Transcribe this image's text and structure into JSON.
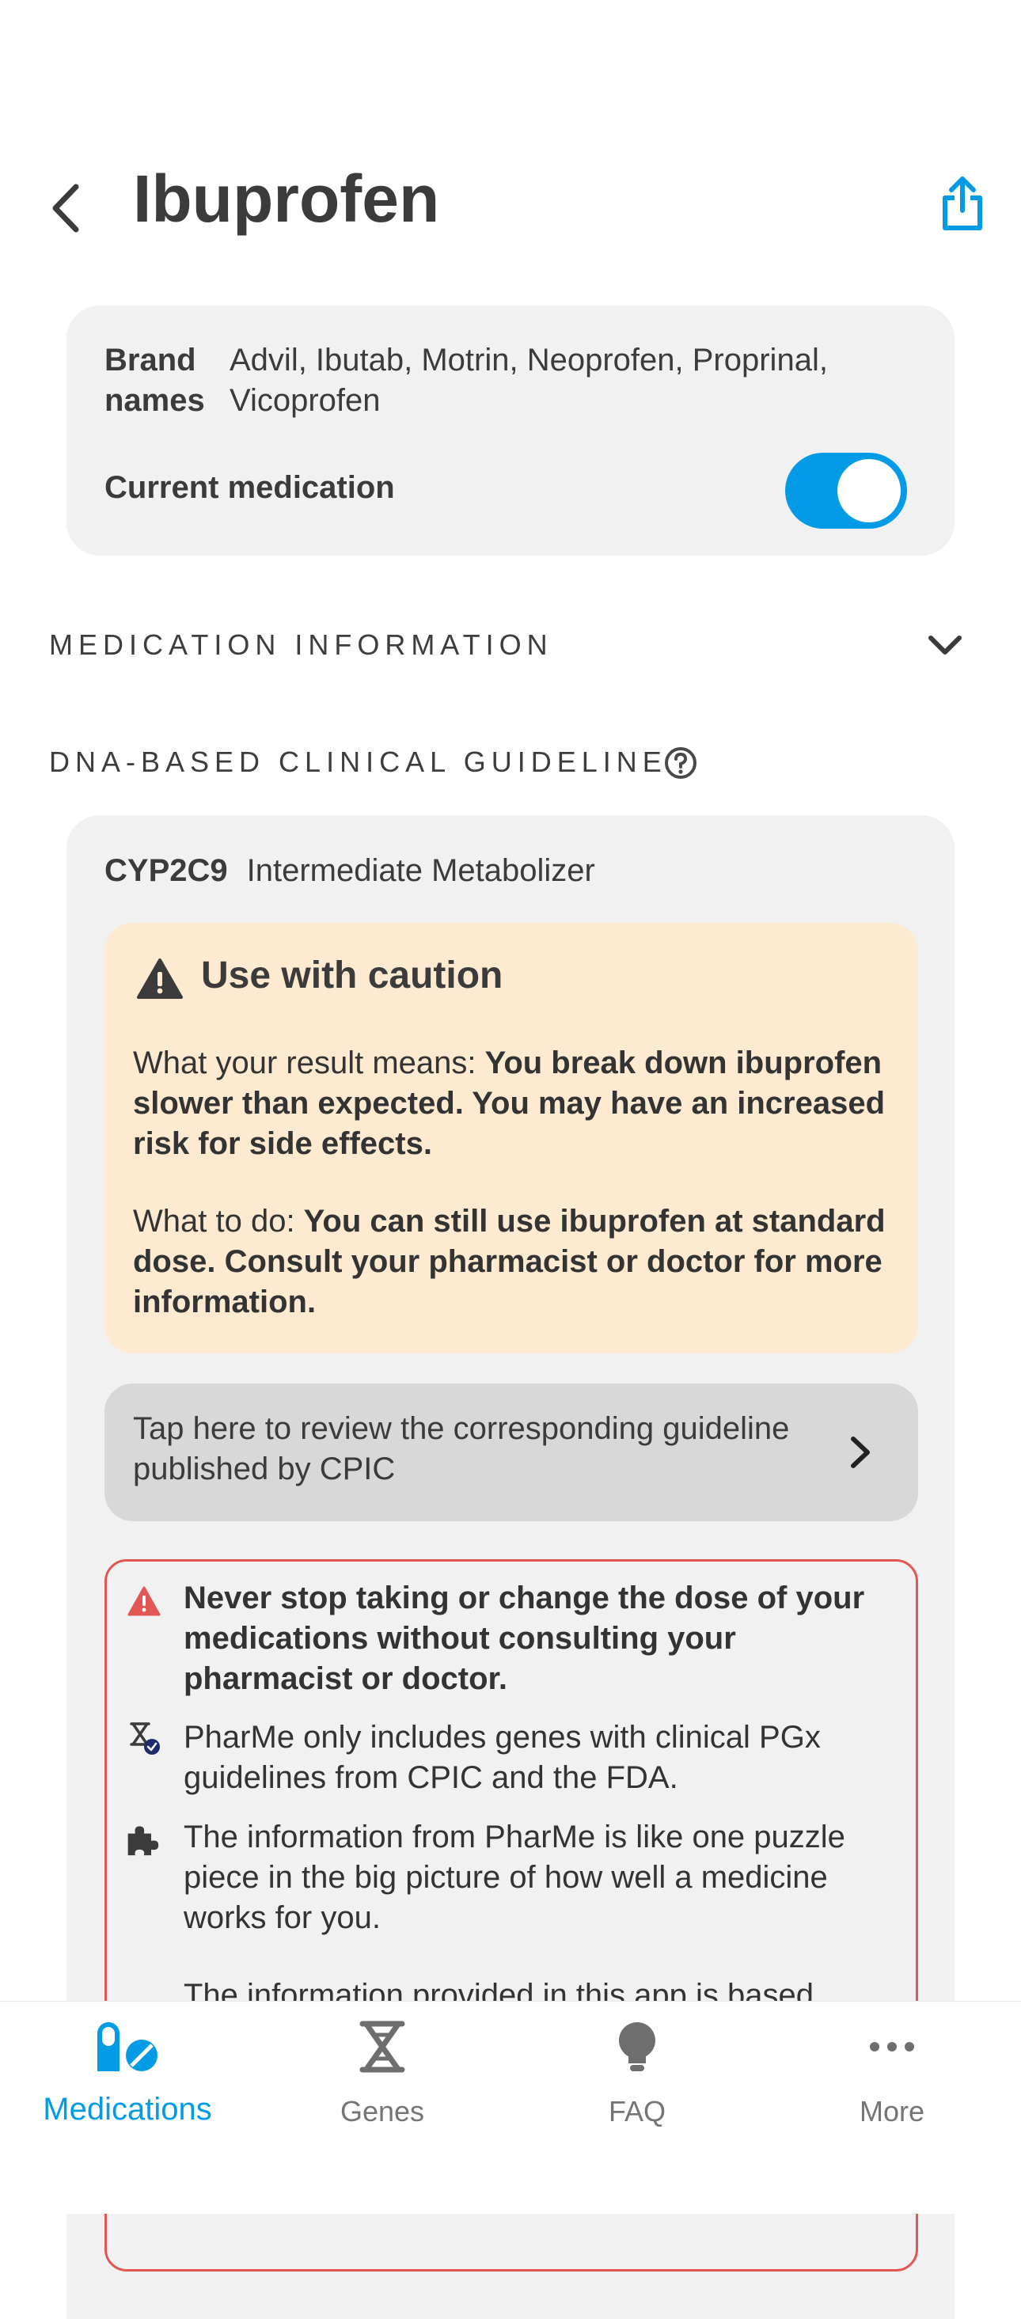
{
  "header": {
    "title": "Ibuprofen",
    "back_icon": "chevron-left-icon",
    "share_icon": "share-icon"
  },
  "info_card": {
    "brand_label": "Brand names",
    "brand_values": "Advil, Ibutab, Motrin, Neoprofen, Proprinal, Vicoprofen",
    "current_label": "Current medication",
    "current_on": true
  },
  "sections": {
    "medication_info": "MEDICATION INFORMATION",
    "guideline": "DNA-BASED CLINICAL GUIDELINE"
  },
  "guideline": {
    "gene": "CYP2C9",
    "phenotype": "Intermediate Metabolizer",
    "caution_title": "Use with caution",
    "result_prefix": "What your result means: ",
    "result_text": "You break down ibuprofen slower than expected. You may have an increased risk for side effects.",
    "todo_prefix": "What to do: ",
    "todo_text": "You can still use ibuprofen at standard dose. Consult your pharmacist or doctor for more information.",
    "cpic_link": "Tap here to review the corresponding guideline published by CPIC"
  },
  "disclaimer": {
    "items": [
      "Never stop taking or change the dose of your medications without consulting your pharmacist or doctor.",
      "PharMe only includes genes with clinical PGx guidelines from CPIC and the FDA.",
      "The information from PharMe is like one puzzle piece in the big picture of how well a medicine works for you.",
      "The information provided in this app is based"
    ]
  },
  "colors": {
    "accent": "#039be5",
    "caution_bg": "#fdead0",
    "warning_red": "#e25656"
  },
  "nav": {
    "items": [
      {
        "label": "Medications",
        "icon": "pills-icon",
        "active": true
      },
      {
        "label": "Genes",
        "icon": "dna-icon",
        "active": false
      },
      {
        "label": "FAQ",
        "icon": "lightbulb-icon",
        "active": false
      },
      {
        "label": "More",
        "icon": "more-dots-icon",
        "active": false
      }
    ]
  }
}
